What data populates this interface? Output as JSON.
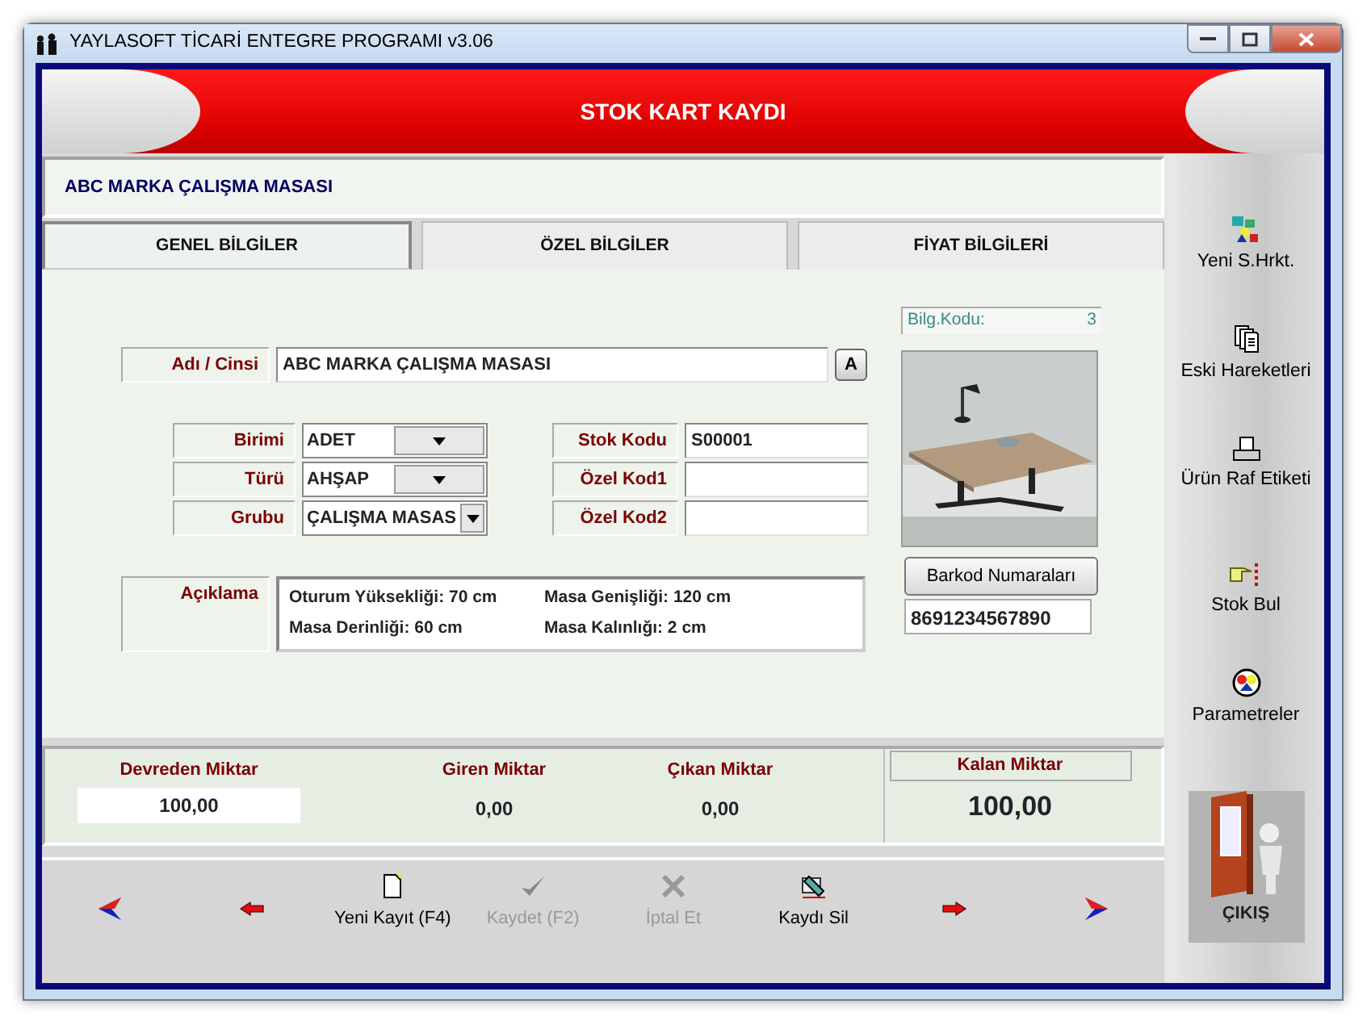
{
  "window": {
    "title": "YAYLASOFT TİCARİ ENTEGRE PROGRAMI v3.06"
  },
  "header": {
    "title": "STOK KART KAYDI"
  },
  "record_name": "ABC MARKA ÇALIŞMA MASASI",
  "tabs": [
    {
      "label": "GENEL BİLGİLER",
      "selected": true
    },
    {
      "label": "ÖZEL BİLGİLER",
      "selected": false
    },
    {
      "label": "FİYAT BİLGİLERİ",
      "selected": false
    }
  ],
  "name_field": {
    "label": "Adı / Cinsi",
    "value": "ABC MARKA ÇALIŞMA MASASI",
    "button": "A"
  },
  "combos": [
    {
      "label": "Birimi",
      "value": "ADET"
    },
    {
      "label": "Türü",
      "value": "AHŞAP"
    },
    {
      "label": "Grubu",
      "value": "ÇALIŞMA MASAS"
    }
  ],
  "codes": [
    {
      "label": "Stok Kodu",
      "value": "S00001"
    },
    {
      "label": "Özel Kod1"
    },
    {
      "label": "Özel Kod2"
    }
  ],
  "description": {
    "label": "Açıklama",
    "lines": [
      [
        "Oturum Yüksekliği: 70 cm",
        "Masa Genişliği:  120 cm"
      ],
      [
        "Masa Derinliği: 60 cm",
        "Masa Kalınlığı: 2 cm"
      ]
    ]
  },
  "info": {
    "label": "Bilg.Kodu:",
    "value": "3"
  },
  "barcode": {
    "button": "Barkod Numaraları",
    "value": "8691234567890"
  },
  "totals": [
    {
      "label": "Devreden Miktar",
      "value": "100,00",
      "kind": "field"
    },
    {
      "label": "Giren Miktar",
      "value": "0,00",
      "kind": "plain"
    },
    {
      "label": "Çıkan Miktar",
      "value": "0,00",
      "kind": "plain"
    },
    {
      "label": "Kalan Miktar",
      "value": "100,00",
      "kind": "boxed"
    }
  ],
  "toolbar": [
    {
      "kind": "first"
    },
    {
      "kind": "prev"
    },
    {
      "kind": "button",
      "label": "Yeni Kayıt (F4)",
      "disabled": false
    },
    {
      "kind": "button",
      "label": "Kaydet (F2)",
      "disabled": true
    },
    {
      "kind": "button",
      "label": "İptal Et",
      "disabled": true
    },
    {
      "kind": "button",
      "label": "Kaydı Sil",
      "disabled": false
    },
    {
      "kind": "next"
    },
    {
      "kind": "last"
    }
  ],
  "sidebar": {
    "items": [
      {
        "label": "Yeni S.Hrkt."
      },
      {
        "label": "Eski Hareketleri"
      },
      {
        "label": "Ürün Raf Etiketi"
      },
      {
        "label": "Stok Bul"
      },
      {
        "label": "Parametreler"
      }
    ],
    "exit": {
      "label": "ÇIKIŞ"
    }
  }
}
